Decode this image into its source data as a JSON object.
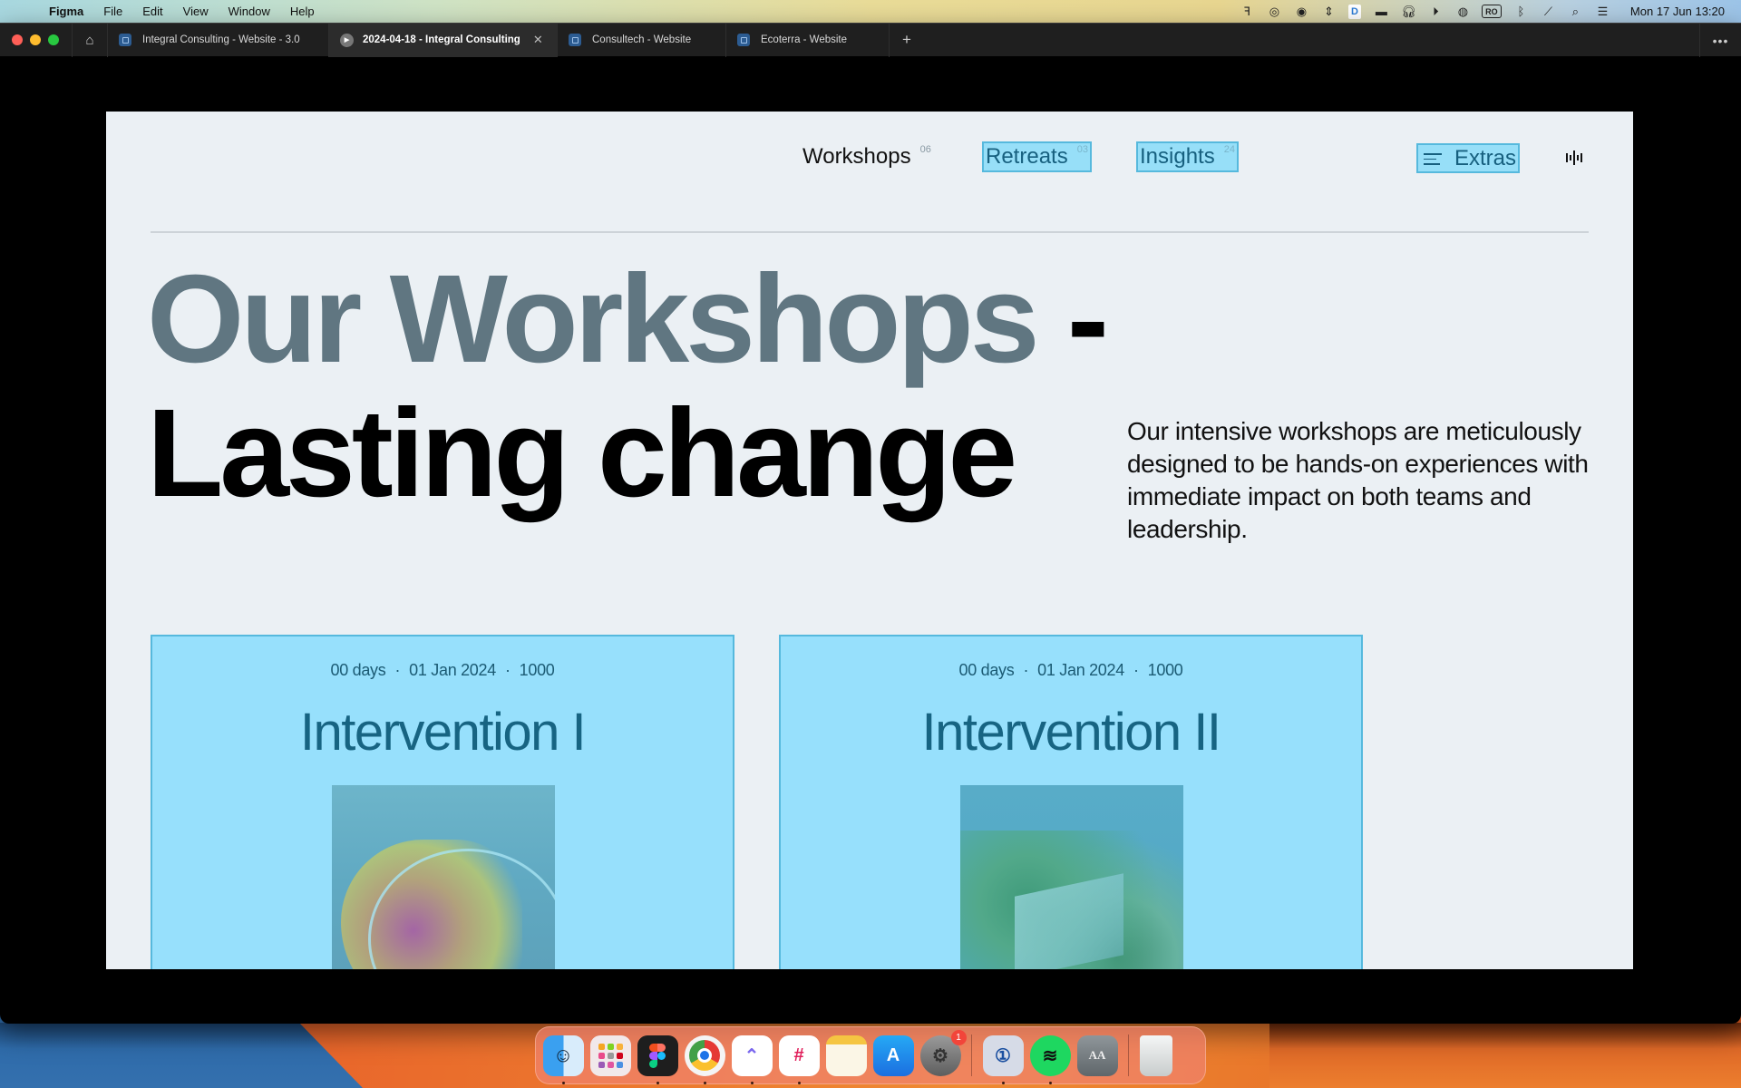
{
  "menubar": {
    "app_name": "Figma",
    "menus": [
      "File",
      "Edit",
      "View",
      "Window",
      "Help"
    ],
    "status_icons": [
      "figma-icon",
      "creative-cloud-lock-icon",
      "creative-cloud-icon",
      "arrows-updown-icon",
      "dropbox-d-icon",
      "screen-icon",
      "headphones-icon",
      "play-circle-icon",
      "user-circle-icon",
      "ro-input-icon",
      "bluetooth-icon",
      "wifi-off-icon",
      "search-icon",
      "control-center-icon"
    ],
    "ro_label": "RO",
    "dbox_label": "D",
    "clock": "Mon 17 Jun  13:20"
  },
  "tabs": [
    {
      "label": "Integral Consulting - Website - 3.0",
      "active": false,
      "icon": "figma-file-icon"
    },
    {
      "label": "2024-04-18 - Integral Consulting",
      "active": true,
      "icon": "play-icon"
    },
    {
      "label": "Consultech - Website",
      "active": false,
      "icon": "figma-file-icon"
    },
    {
      "label": "Ecoterra - Website",
      "active": false,
      "icon": "figma-file-icon"
    }
  ],
  "tab_controls": {
    "new_tab": "+",
    "close": "✕",
    "more": "•••",
    "home": "⌂"
  },
  "nav": {
    "items": [
      {
        "label": "Workshops",
        "count": "06"
      },
      {
        "label": "Retreats",
        "count": "03"
      },
      {
        "label": "Insights",
        "count": "24"
      }
    ],
    "extras_label": "Extras"
  },
  "hero": {
    "line1": "Our Workshops",
    "dash": " -",
    "line2": "Lasting change",
    "description": "Our intensive workshops are meticulously designed to be hands-on experiences with immediate impact on both teams and leadership."
  },
  "cards": [
    {
      "duration": "00 days",
      "date": "01 Jan 2024",
      "price": "1000",
      "title": "Intervention I",
      "separator": "·"
    },
    {
      "duration": "00 days",
      "date": "01 Jan 2024",
      "price": "1000",
      "title": "Intervention II",
      "separator": "·"
    }
  ],
  "colors": {
    "frame_bg": "#ebf0f4",
    "card_bg": "#97e0fc",
    "card_border": "#56b9dd",
    "card_text": "#176482",
    "headline_muted": "#607681"
  },
  "dock": {
    "apps": [
      "Finder",
      "Launchpad",
      "Figma",
      "Google Chrome",
      "ClickUp",
      "Slack",
      "Notes",
      "App Store",
      "System Settings",
      "1Password",
      "Spotify",
      "Font Book",
      "Trash"
    ],
    "settings_badge": "1",
    "fontbook_glyph": "AA\nAa"
  }
}
